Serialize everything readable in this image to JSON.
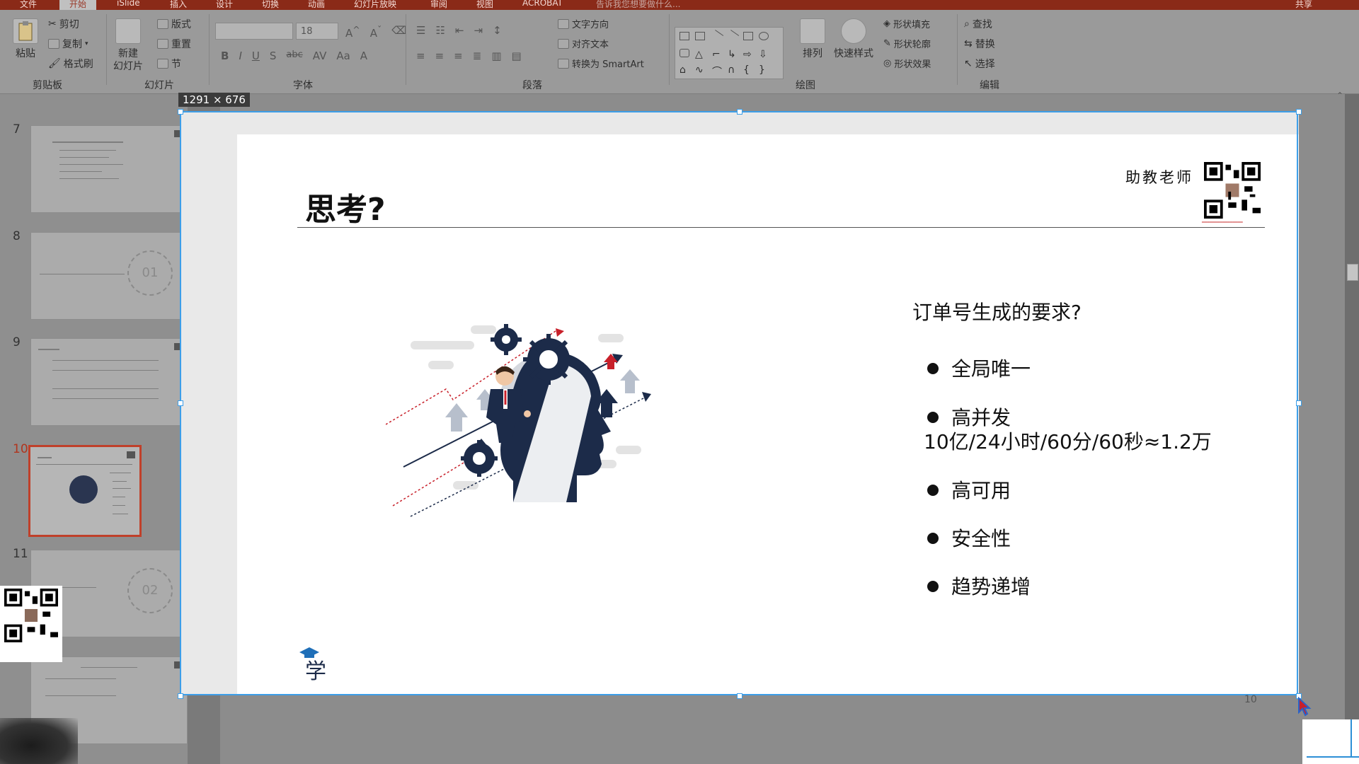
{
  "menu": {
    "tabs": [
      "文件",
      "开始",
      "iSlide",
      "插入",
      "设计",
      "切换",
      "动画",
      "幻灯片放映",
      "审阅",
      "视图",
      "ACROBAT"
    ],
    "active_tab": "开始",
    "tell_me": "告诉我您想要做什么...",
    "share": "共享"
  },
  "ribbon": {
    "clipboard": {
      "paste": "粘贴",
      "cut": "剪切",
      "copy": "复制",
      "format_painter": "格式刷",
      "label": "剪贴板"
    },
    "slides": {
      "new_slide_line1": "新建",
      "new_slide_line2": "幻灯片",
      "layout": "版式",
      "reset": "重置",
      "section": "节",
      "label": "幻灯片"
    },
    "font": {
      "font_size": "18",
      "label": "字体",
      "buttons": [
        "B",
        "I",
        "U",
        "S",
        "abc",
        "AV",
        "Aa",
        "A"
      ]
    },
    "paragraph": {
      "text_direction": "文字方向",
      "align_text": "对齐文本",
      "convert_smartart": "转换为 SmartArt",
      "label": "段落"
    },
    "drawing": {
      "arrange": "排列",
      "quick_styles": "快速样式",
      "shape_fill": "形状填充",
      "shape_outline": "形状轮廓",
      "shape_effects": "形状效果",
      "label": "绘图"
    },
    "editing": {
      "find": "查找",
      "replace": "替换",
      "select": "选择",
      "label": "编辑"
    }
  },
  "thumbnails": [
    {
      "num": "7",
      "active": false
    },
    {
      "num": "8",
      "active": false,
      "badge": "01"
    },
    {
      "num": "9",
      "active": false
    },
    {
      "num": "10",
      "active": true
    },
    {
      "num": "11",
      "active": false,
      "badge": "02"
    }
  ],
  "size_tooltip": "1291 × 676",
  "slide": {
    "title": "思考?",
    "ta_label": "助教老师",
    "question": "订单号生成的要求?",
    "bullets": [
      "全局唯一",
      "高并发",
      "高可用",
      "安全性",
      "趋势递增"
    ],
    "calc_line": "10亿/24小时/60分/60秒≈1.2万",
    "logo_text": "学",
    "number": "10"
  },
  "colors": {
    "accent_blue": "#3d9ee8",
    "navy": "#1c2b49",
    "red_accent": "#c8202a",
    "selection_red": "#c0402a"
  }
}
